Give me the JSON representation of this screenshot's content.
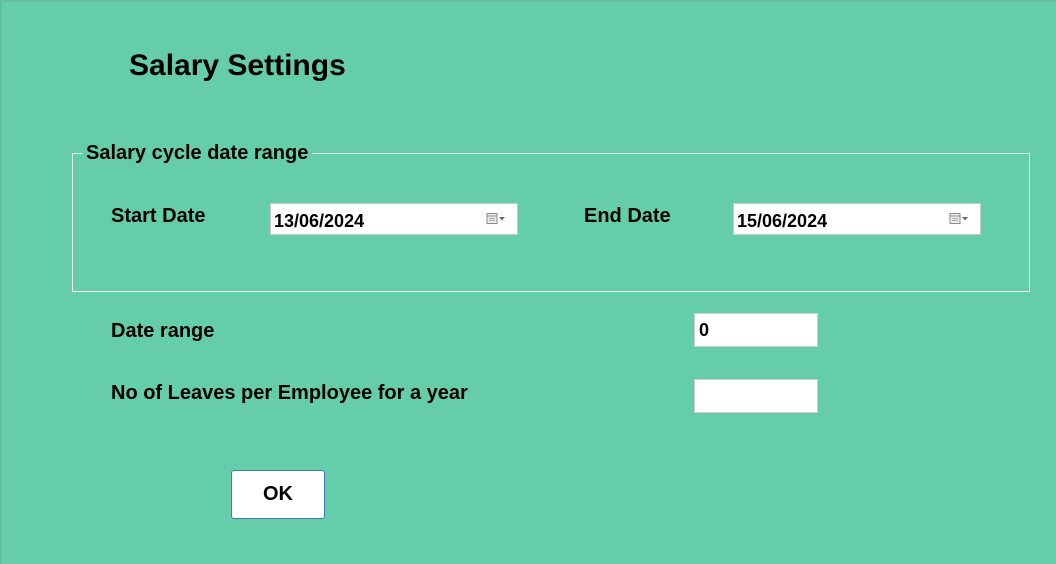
{
  "page": {
    "title": "Salary Settings"
  },
  "salary_cycle": {
    "legend": "Salary cycle date range",
    "start_date": {
      "label": "Start Date",
      "value": "13/06/2024",
      "icon": "calendar-dropdown-icon"
    },
    "end_date": {
      "label": "End Date",
      "value": "15/06/2024",
      "icon": "calendar-dropdown-icon"
    }
  },
  "date_range": {
    "label": "Date range",
    "value": "0"
  },
  "leaves": {
    "label": "No of Leaves per Employee for a year",
    "value": ""
  },
  "actions": {
    "ok_label": "OK"
  },
  "colors": {
    "background": "#66cdaa",
    "field_background": "#ffffff",
    "group_border": "#e8f7f1",
    "button_border": "#3b79b8"
  }
}
